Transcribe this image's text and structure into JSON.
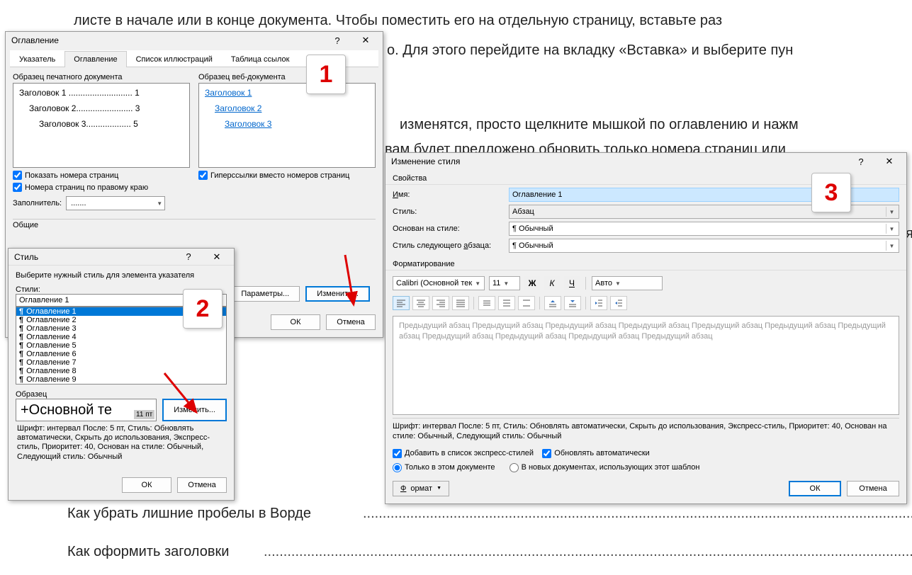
{
  "bg": {
    "line1": "листе в начале или в конце документа. Чтобы поместить его на отдельную страницу, вставьте раз",
    "line2_a": "о. Для этого перейдите на вкладку «Вставка» и выберите пун",
    "line3": "изменятся, просто щелкните мышкой по оглавлению и нажм",
    "line4": "вам будет предложено обновить только номера страниц или",
    "line_r1": "я",
    "line_bottom1": "Как убрать лишние пробелы в Ворде",
    "line_bottom2": "Как оформить заголовки",
    "dots": "....................................................................................................................................................................................."
  },
  "dlg1": {
    "title": "Оглавление",
    "tabs": {
      "t1": "Указатель",
      "t2": "Оглавление",
      "t3": "Список иллюстраций",
      "t4": "Таблица ссылок"
    },
    "preview_print_lbl": "Образец печатного документа",
    "preview_web_lbl": "Образец веб-документа",
    "p_lines": {
      "l1": "Заголовок 1 ........................... 1",
      "l2": "Заголовок 2........................ 3",
      "l3": "Заголовок 3................... 5"
    },
    "w_lines": {
      "l1": "Заголовок 1",
      "l2": "Заголовок 2",
      "l3": "Заголовок 3"
    },
    "chk_pagenum": "Показать номера страниц",
    "chk_hyper": "Гиперссылки вместо номеров страниц",
    "chk_right": "Номера страниц по правому краю",
    "fill_lbl": "Заполнитель:",
    "fill_val": ".......",
    "general_lbl": "Общие",
    "btn_params": "Параметры...",
    "btn_modify": "Изменить...",
    "btn_ok": "ОК",
    "btn_cancel": "Отмена"
  },
  "dlg2": {
    "title": "Стиль",
    "hint": "Выберите нужный стиль для элемента указателя",
    "styles_lbl": "Стили:",
    "input_val": "Оглавление 1",
    "items": [
      "Оглавление 1",
      "Оглавление 2",
      "Оглавление 3",
      "Оглавление 4",
      "Оглавление 5",
      "Оглавление 6",
      "Оглавление 7",
      "Оглавление 8",
      "Оглавление 9"
    ],
    "sample_lbl": "Образец",
    "sample_text": "+Основной те",
    "sample_size": "11 пт",
    "btn_modify": "Изменить...",
    "desc": "Шрифт: интервал После:  5 пт, Стиль: Обновлять автоматически, Скрыть до использования, Экспресс-стиль, Приоритет: 40, Основан на стиле: Обычный, Следующий стиль: Обычный",
    "btn_ok": "ОК",
    "btn_cancel": "Отмена"
  },
  "dlg3": {
    "title": "Изменение стиля",
    "grp_props": "Свойства",
    "name_lbl": "Имя:",
    "name_val": "Оглавление 1",
    "style_lbl": "Стиль:",
    "style_val": "Абзац",
    "based_lbl": "Основан на стиле:",
    "based_val": "¶ Обычный",
    "next_lbl": "Стиль следующего абзаца:",
    "next_val": "¶ Обычный",
    "grp_fmt": "Форматирование",
    "font_val": "Calibri (Основной тек",
    "size_val": "11",
    "bold": "Ж",
    "italic": "К",
    "under": "Ч",
    "color_val": "Авто",
    "preview_text": "Предыдущий абзац Предыдущий абзац Предыдущий абзац Предыдущий абзац Предыдущий абзац Предыдущий абзац Предыдущий абзац Предыдущий абзац Предыдущий абзац Предыдущий абзац Предыдущий абзац",
    "desc": "Шрифт: интервал После:  5 пт, Стиль: Обновлять автоматически, Скрыть до использования, Экспресс-стиль, Приоритет: 40, Основан на стиле: Обычный, Следующий стиль: Обычный",
    "chk_express": "Добавить в список экспресс-стилей",
    "chk_auto": "Обновлять автоматически",
    "radio_doc": "Только в этом документе",
    "radio_tmpl": "В новых документах, использующих этот шаблон",
    "btn_format": "Формат",
    "btn_ok": "ОК",
    "btn_cancel": "Отмена"
  },
  "callouts": {
    "c1": "1",
    "c2": "2",
    "c3": "3"
  }
}
